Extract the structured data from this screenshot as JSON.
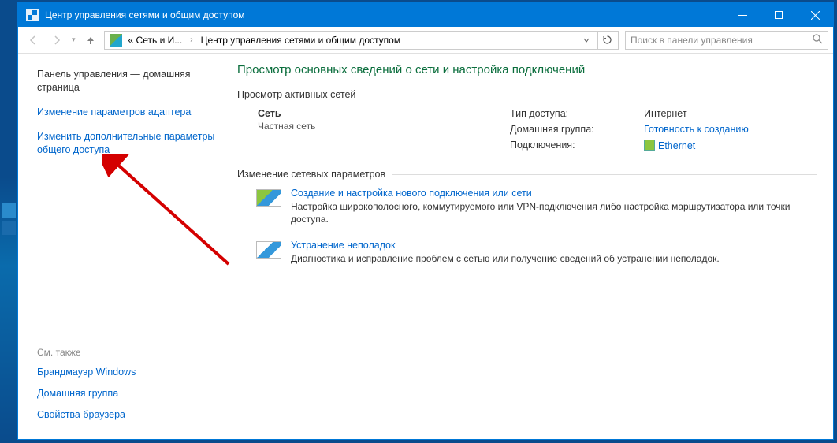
{
  "titlebar": {
    "text": "Центр управления сетями и общим доступом"
  },
  "breadcrumb": {
    "seg1_short": "« Сеть и И...",
    "seg2": "Центр управления сетями и общим доступом"
  },
  "search": {
    "placeholder": "Поиск в панели управления"
  },
  "sidebar": {
    "home": "Панель управления — домашняя страница",
    "link1": "Изменение параметров адаптера",
    "link2": "Изменить дополнительные параметры общего доступа",
    "see_also_hdr": "См. также",
    "see1": "Брандмауэр Windows",
    "see2": "Домашняя группа",
    "see3": "Свойства браузера"
  },
  "main": {
    "title": "Просмотр основных сведений о сети и настройка подключений",
    "active_hdr": "Просмотр активных сетей",
    "net": {
      "name": "Сеть",
      "type": "Частная сеть",
      "access_k": "Тип доступа:",
      "access_v": "Интернет",
      "homegroup_k": "Домашняя группа:",
      "homegroup_v": "Готовность к созданию",
      "conn_k": "Подключения:",
      "conn_v": "Ethernet"
    },
    "change_hdr": "Изменение сетевых параметров",
    "task1": {
      "title": "Создание и настройка нового подключения или сети",
      "desc": "Настройка широкополосного, коммутируемого или VPN-подключения либо настройка маршрутизатора или точки доступа."
    },
    "task2": {
      "title": "Устранение неполадок",
      "desc": "Диагностика и исправление проблем с сетью или получение сведений об устранении неполадок."
    }
  }
}
